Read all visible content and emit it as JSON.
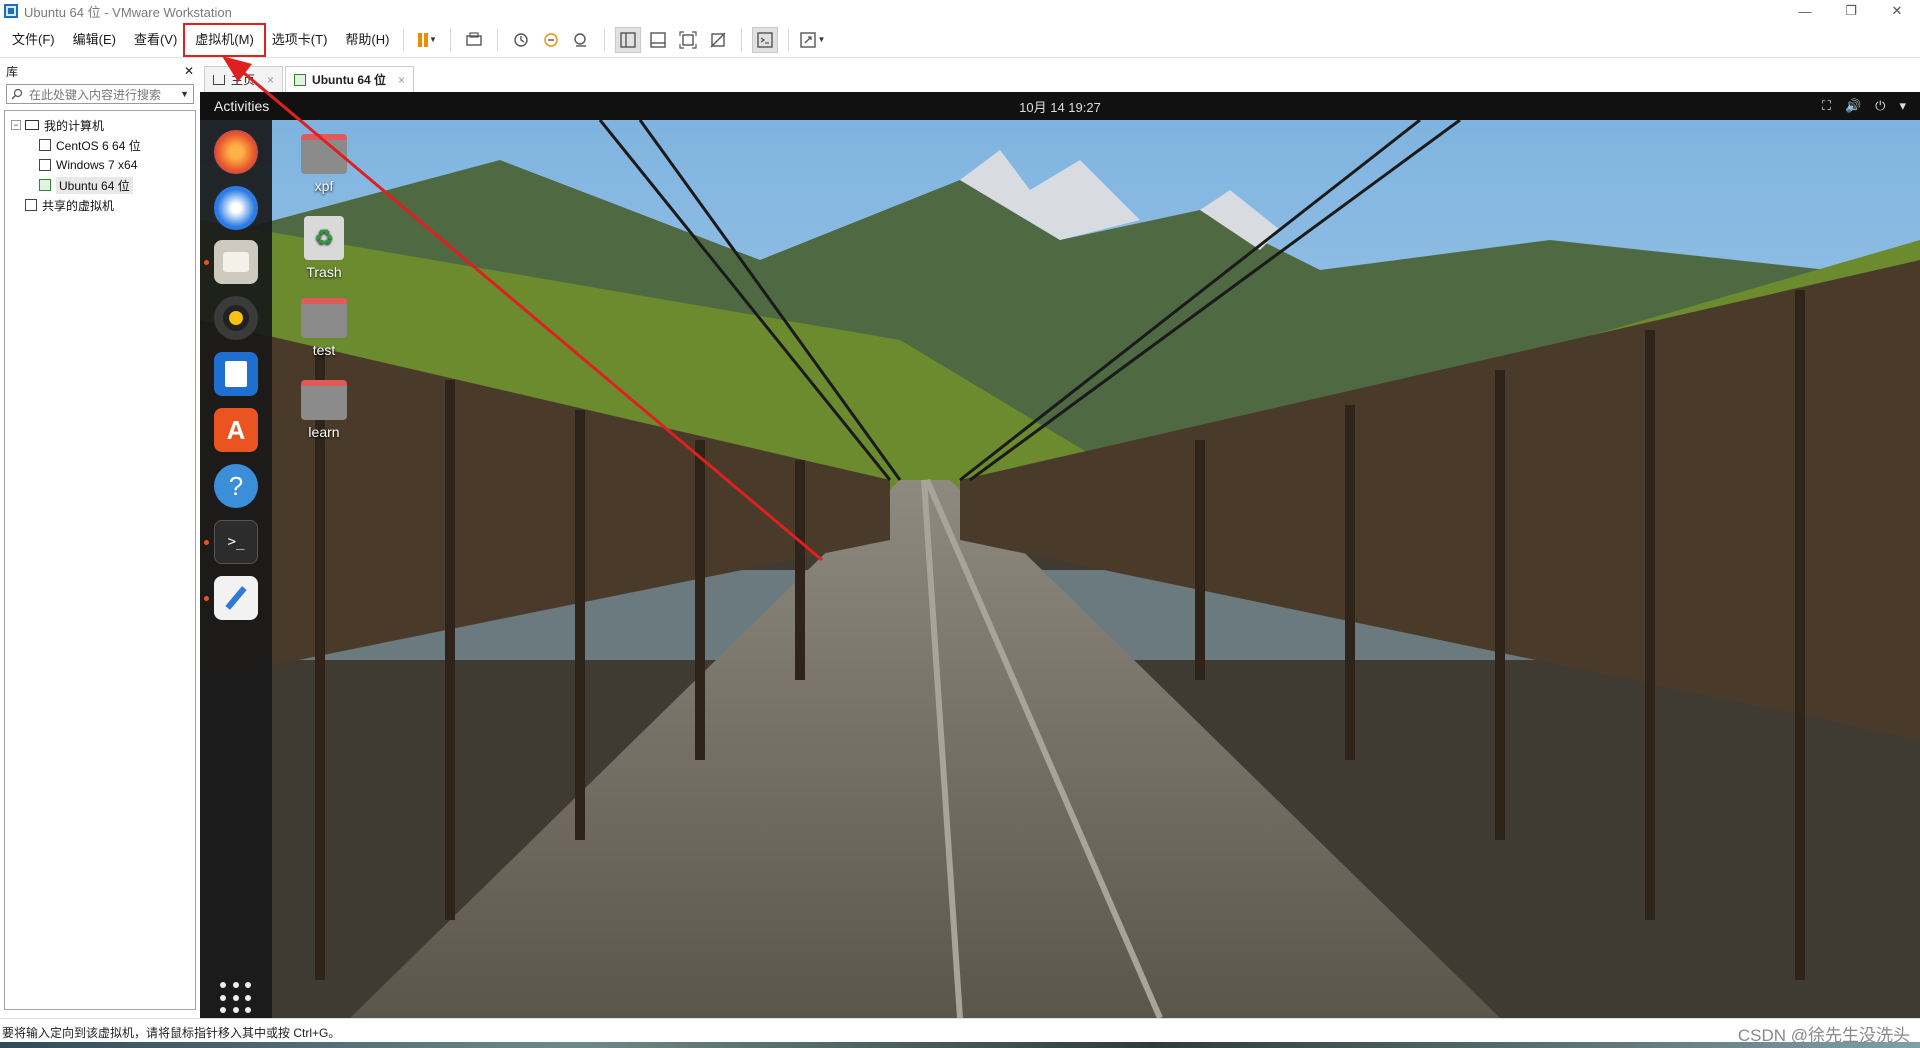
{
  "window": {
    "title": "Ubuntu 64 位 - VMware Workstation",
    "controls": {
      "minimize": "—",
      "restore": "❐",
      "close": "✕"
    }
  },
  "menu": {
    "file": "文件(F)",
    "edit": "编辑(E)",
    "view": "查看(V)",
    "vm": "虚拟机(M)",
    "tabs": "选项卡(T)",
    "help": "帮助(H)"
  },
  "library": {
    "title": "库",
    "close": "✕",
    "search_placeholder": "在此处键入内容进行搜索",
    "tree": {
      "my_computer": "我的计算机",
      "vms": [
        "CentOS 6 64 位",
        "Windows 7 x64",
        "Ubuntu 64 位"
      ],
      "shared": "共享的虚拟机"
    }
  },
  "tabs": [
    {
      "label": "主页",
      "close": "×"
    },
    {
      "label": "Ubuntu 64 位",
      "close": "×"
    }
  ],
  "guest": {
    "activities": "Activities",
    "clock": "10月 14  19:27",
    "tray": {
      "network": "⛶",
      "volume": "🔊",
      "power": "⏻",
      "menu": "▾"
    },
    "desktop_icons": [
      "xpf",
      "Trash",
      "test",
      "learn"
    ]
  },
  "statusbar": {
    "message": "要将输入定向到该虚拟机，请将鼠标指针移入其中或按 Ctrl+G。",
    "watermark": "CSDN @徐先生没洗头"
  },
  "colors": {
    "accent_orange": "#f08a00",
    "annotation_red": "#e02020",
    "ubuntu_orange": "#e95420",
    "topbar": "#111111"
  }
}
